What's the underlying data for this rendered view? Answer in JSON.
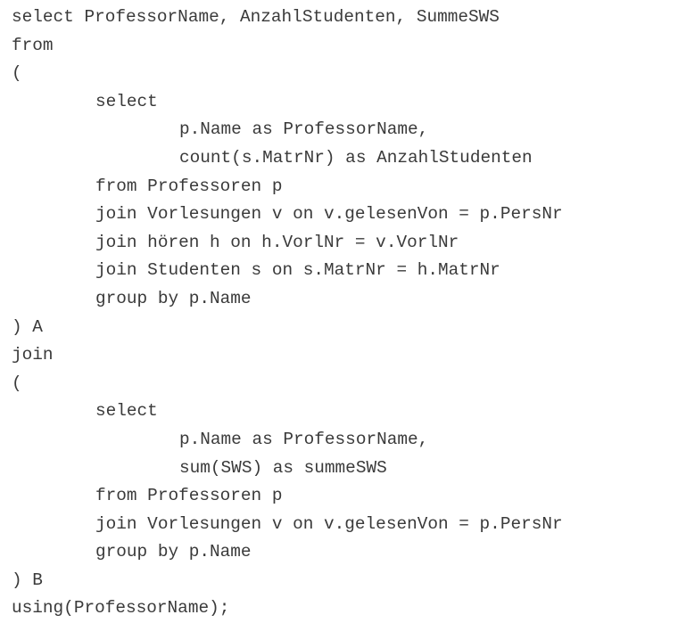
{
  "code": {
    "lines": [
      {
        "text": "select ProfessorName, AnzahlStudenten, SummeSWS",
        "indent": 0
      },
      {
        "text": "from",
        "indent": 0
      },
      {
        "text": "(",
        "indent": 0
      },
      {
        "text": "select",
        "indent": 1
      },
      {
        "text": "p.Name as ProfessorName,",
        "indent": 2
      },
      {
        "text": "count(s.MatrNr) as AnzahlStudenten",
        "indent": 2
      },
      {
        "text": "from Professoren p",
        "indent": 1
      },
      {
        "text": "join Vorlesungen v on v.gelesenVon = p.PersNr",
        "indent": 1
      },
      {
        "text": "join hören h on h.VorlNr = v.VorlNr",
        "indent": 1
      },
      {
        "text": "join Studenten s on s.MatrNr = h.MatrNr",
        "indent": 1
      },
      {
        "text": "group by p.Name",
        "indent": 1
      },
      {
        "text": ") A",
        "indent": 0
      },
      {
        "text": "join",
        "indent": 0
      },
      {
        "text": "(",
        "indent": 0
      },
      {
        "text": "select",
        "indent": 1
      },
      {
        "text": "p.Name as ProfessorName,",
        "indent": 2
      },
      {
        "text": "sum(SWS) as summeSWS",
        "indent": 2
      },
      {
        "text": "from Professoren p",
        "indent": 1
      },
      {
        "text": "join Vorlesungen v on v.gelesenVon = p.PersNr",
        "indent": 1
      },
      {
        "text": "group by p.Name",
        "indent": 1
      },
      {
        "text": ") B",
        "indent": 0
      },
      {
        "text": "using(ProfessorName);",
        "indent": 0
      }
    ]
  }
}
